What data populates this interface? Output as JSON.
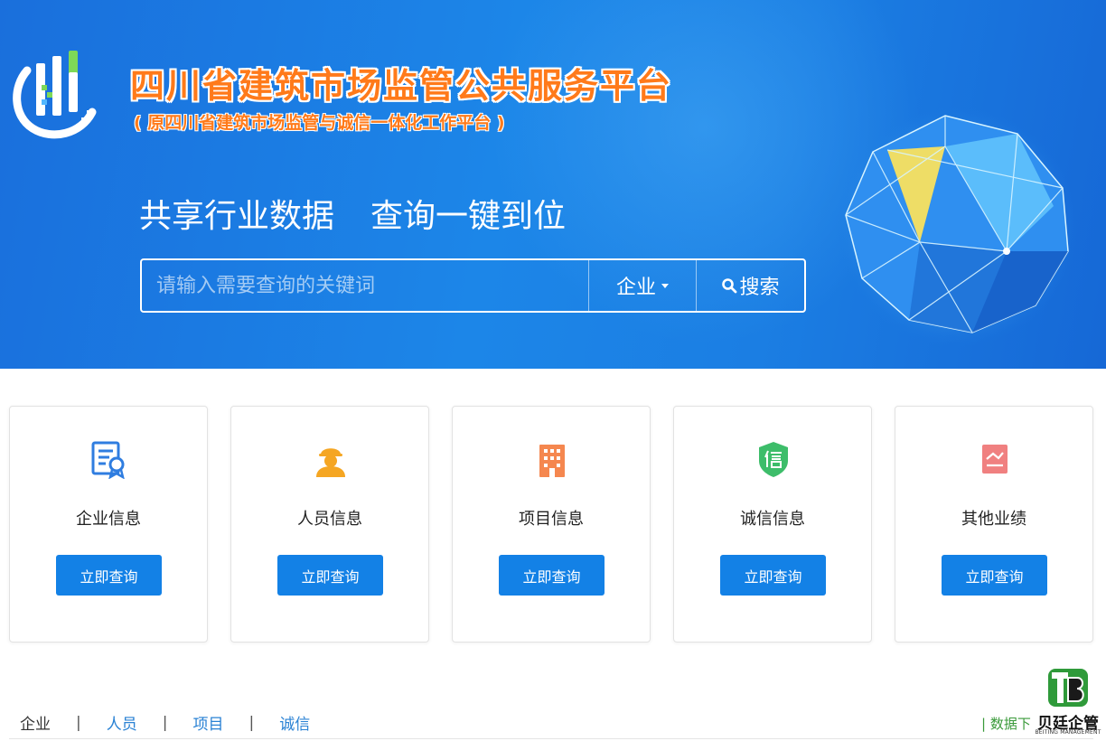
{
  "header": {
    "title": "四川省建筑市场监管公共服务平台",
    "subtitle": "( 原四川省建筑市场监管与诚信一体化工作平台 )",
    "slogan_left": "共享行业数据",
    "slogan_right": "查询一键到位"
  },
  "search": {
    "placeholder": "请输入需要查询的关键词",
    "type_selected": "企业",
    "button_label": "搜索"
  },
  "cards": [
    {
      "title": "企业信息",
      "button": "立即查询",
      "icon": "certificate-icon",
      "color": "#2f7de0"
    },
    {
      "title": "人员信息",
      "button": "立即查询",
      "icon": "worker-icon",
      "color": "#f5a623"
    },
    {
      "title": "项目信息",
      "button": "立即查询",
      "icon": "building-icon",
      "color": "#f5874f"
    },
    {
      "title": "诚信信息",
      "button": "立即查询",
      "icon": "credit-shield-icon",
      "color": "#3dbd6a"
    },
    {
      "title": "其他业绩",
      "button": "立即查询",
      "icon": "document-icon",
      "color": "#f08080"
    }
  ],
  "nav": {
    "tabs": [
      "企业",
      "人员",
      "项目",
      "诚信"
    ],
    "separator": "|",
    "download": "| 数据下"
  },
  "watermark": {
    "text": "贝廷企管",
    "sub": "BEITING MANAGEMENT"
  },
  "colors": {
    "banner": "#1c86e8",
    "title_orange": "#ff7a1a",
    "button_blue": "#1381e6",
    "link_blue": "#2a82d4"
  }
}
